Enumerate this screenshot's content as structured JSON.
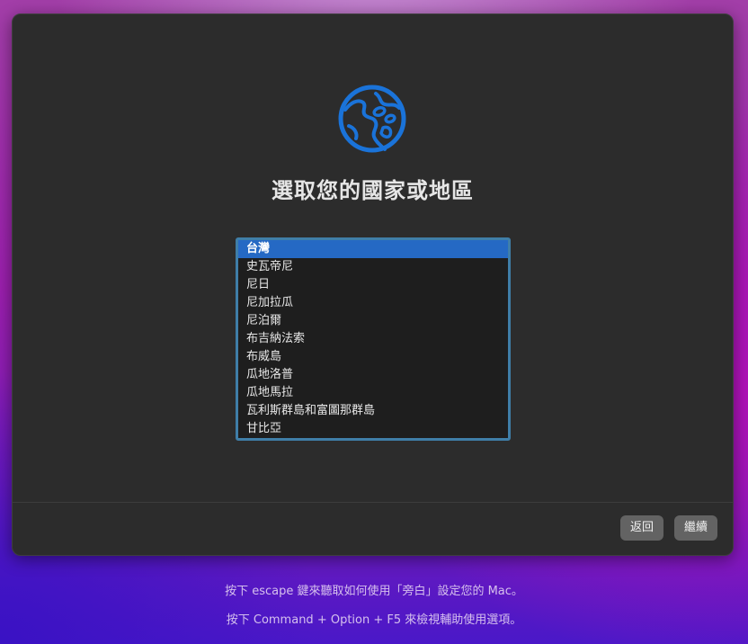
{
  "page": {
    "title": "選取您的國家或地區"
  },
  "countries": {
    "selected": "台灣",
    "items": [
      "台灣",
      "史瓦帝尼",
      "尼日",
      "尼加拉瓜",
      "尼泊爾",
      "布吉納法索",
      "布威島",
      "瓜地洛普",
      "瓜地馬拉",
      "瓦利斯群島和富圖那群島",
      "甘比亞"
    ]
  },
  "buttons": {
    "back": "返回",
    "continue": "繼續"
  },
  "hints": {
    "voiceover": "按下 escape 鍵來聽取如何使用「旁白」設定您的 Mac。",
    "accessibility": "按下 Command + Option + F5 來檢視輔助使用選項。"
  },
  "colors": {
    "accent": "#2569c4",
    "globe": "#1a73d9",
    "window_bg": "#2c2c2c"
  },
  "icons": {
    "globe": "globe-icon"
  }
}
